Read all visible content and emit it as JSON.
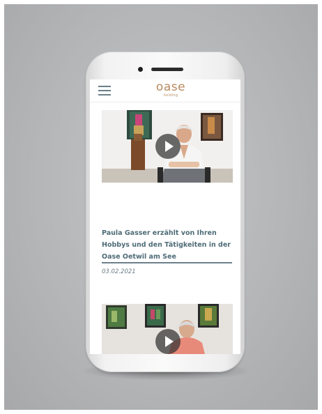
{
  "header": {
    "logo_main": "oase",
    "logo_sub": "holding",
    "menu_icon": "hamburger-menu-icon",
    "brand_color": "#b98a5e"
  },
  "articles": [
    {
      "title": "Paula Gasser erzählt von Ihren Hobbys und den Tätigkeiten in der Oase Oetwil am See",
      "date": "03.02.2021",
      "media": "video-thumbnail",
      "play_icon": "play-icon"
    },
    {
      "media": "video-thumbnail",
      "play_icon": "play-icon"
    }
  ],
  "colors": {
    "title": "#4f6c77",
    "date": "#6a7c84",
    "background": "#b5b6b8"
  }
}
